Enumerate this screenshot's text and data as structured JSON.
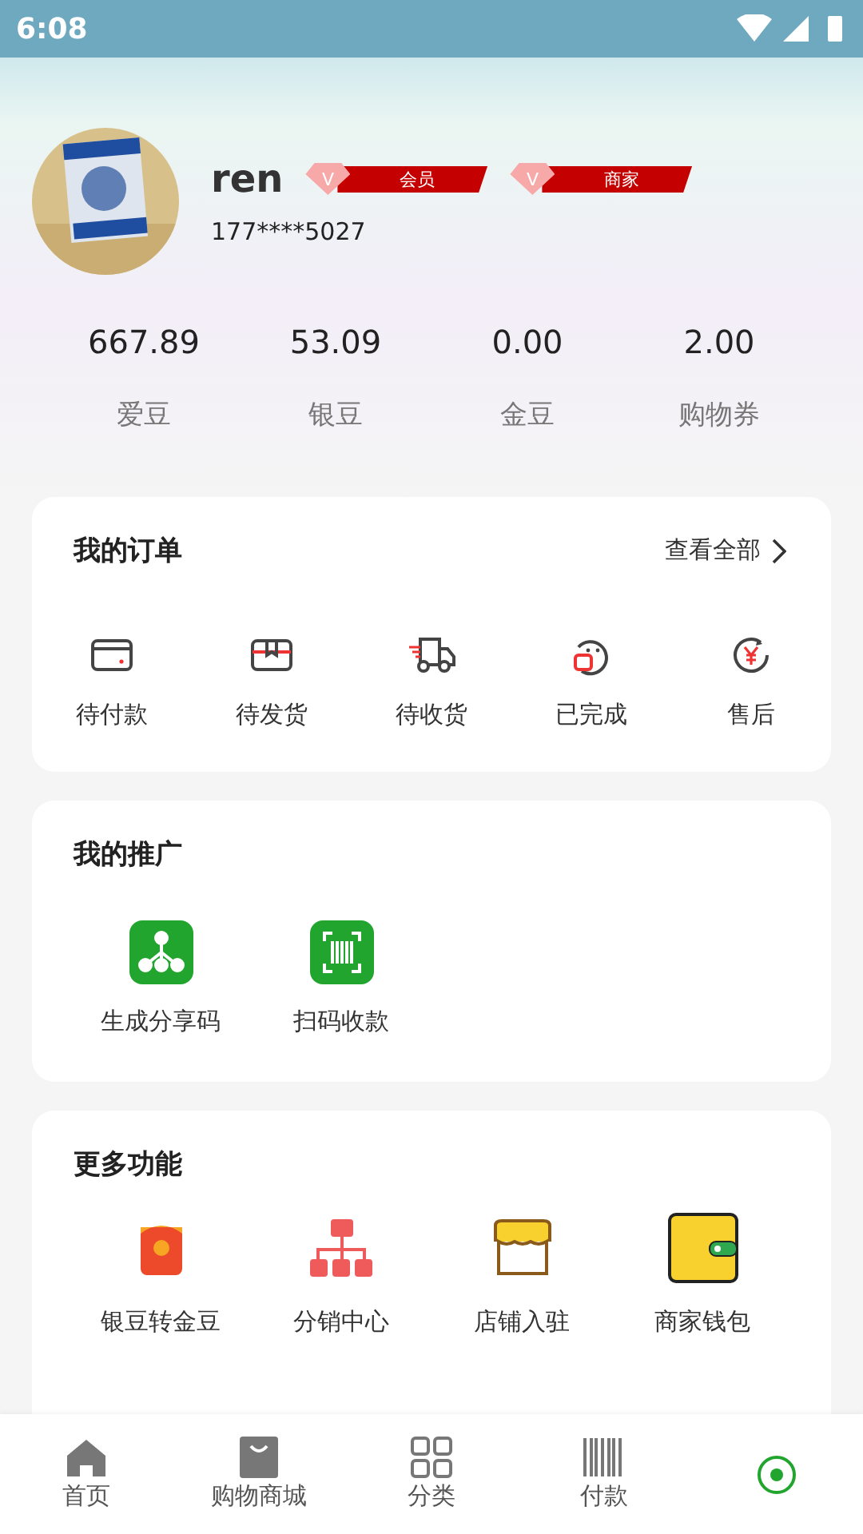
{
  "status_bar": {
    "time": "6:08"
  },
  "profile": {
    "name": "ren",
    "phone": "177****5027",
    "badges": [
      {
        "letter": "V",
        "label": "会员"
      },
      {
        "letter": "V",
        "label": "商家"
      }
    ]
  },
  "stats": [
    {
      "value": "667.89",
      "label": "爱豆"
    },
    {
      "value": "53.09",
      "label": "银豆"
    },
    {
      "value": "0.00",
      "label": "金豆"
    },
    {
      "value": "2.00",
      "label": "购物券"
    }
  ],
  "orders": {
    "title": "我的订单",
    "link": "查看全部",
    "items": [
      {
        "kind": "card",
        "label": "待付款"
      },
      {
        "kind": "box",
        "label": "待发货"
      },
      {
        "kind": "truck",
        "label": "待收货"
      },
      {
        "kind": "face",
        "label": "已完成"
      },
      {
        "kind": "refund",
        "label": "售后"
      }
    ]
  },
  "promotion": {
    "title": "我的推广",
    "items": [
      {
        "kind": "share",
        "label": "生成分享码"
      },
      {
        "kind": "scan",
        "label": "扫码收款"
      }
    ]
  },
  "more": {
    "title": "更多功能",
    "items": [
      {
        "kind": "packet",
        "label": "银豆转金豆"
      },
      {
        "kind": "tree",
        "label": "分销中心"
      },
      {
        "kind": "shop",
        "label": "店铺入驻"
      },
      {
        "kind": "wallet",
        "label": "商家钱包"
      }
    ]
  },
  "tabs": [
    {
      "kind": "home",
      "label": "首页"
    },
    {
      "kind": "bag",
      "label": "购物商城"
    },
    {
      "kind": "grid",
      "label": "分类"
    },
    {
      "kind": "barcode",
      "label": "付款"
    },
    {
      "kind": "circle"
    }
  ]
}
